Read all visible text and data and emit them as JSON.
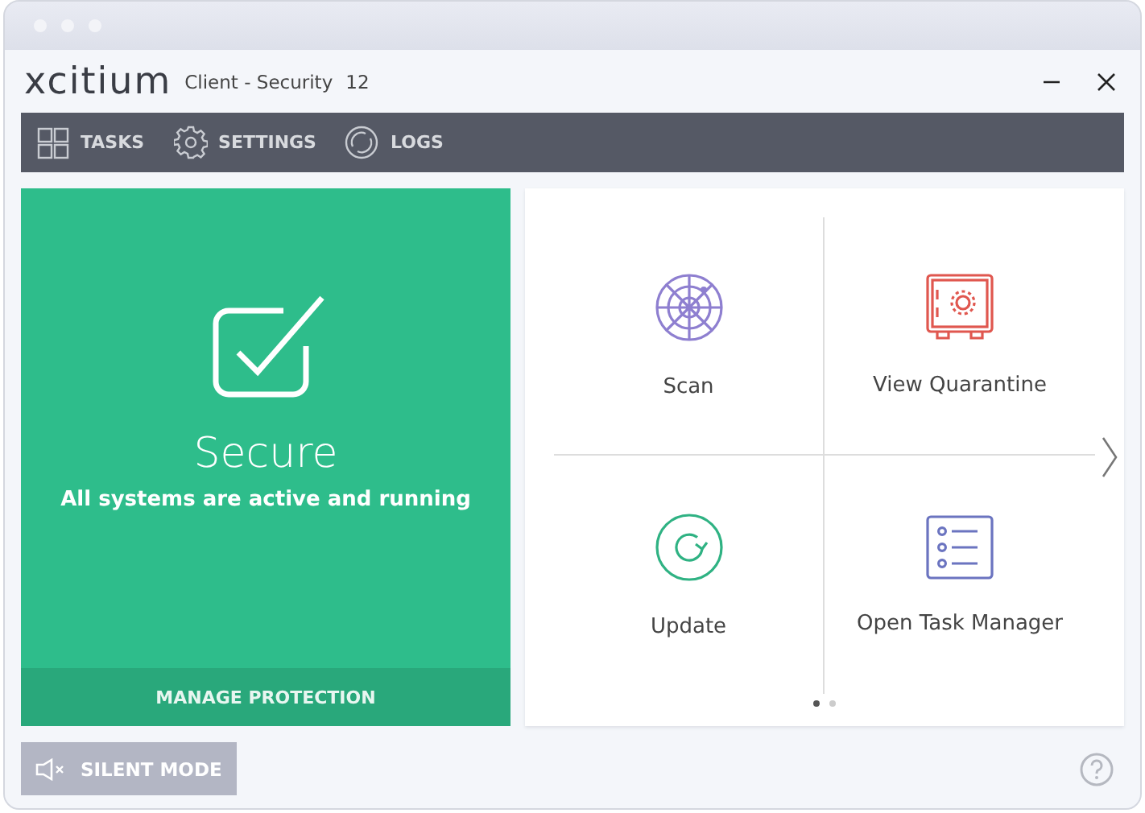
{
  "window": {
    "logo": "xcitium",
    "title": "Client - Security",
    "version": "12"
  },
  "nav": [
    {
      "label": "TASKS",
      "kind": "tasks"
    },
    {
      "label": "SETTINGS",
      "kind": "settings"
    },
    {
      "label": "LOGS",
      "kind": "logs"
    }
  ],
  "status": {
    "title": "Secure",
    "message": "All systems are active and running",
    "action": "MANAGE PROTECTION"
  },
  "tasks": [
    {
      "label": "Scan",
      "kind": "scan"
    },
    {
      "label": "View Quarantine",
      "kind": "quarantine"
    },
    {
      "label": "Update",
      "kind": "update"
    },
    {
      "label": "Open Task Manager",
      "kind": "taskmanager"
    }
  ],
  "pages": [
    {
      "selected": true
    },
    {
      "selected": false
    }
  ],
  "silent_mode": {
    "label": "SILENT MODE"
  }
}
